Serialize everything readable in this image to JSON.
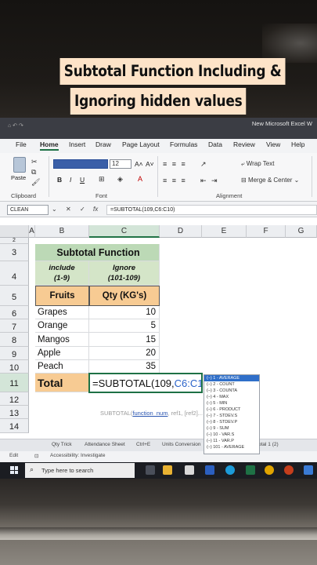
{
  "caption": {
    "line1": "Subtotal Function Including &",
    "line2": "Ignoring hidden values"
  },
  "window": {
    "title": "New Microsoft Excel W"
  },
  "tabs": [
    "File",
    "Home",
    "Insert",
    "Draw",
    "Page Layout",
    "Formulas",
    "Data",
    "Review",
    "View",
    "Help"
  ],
  "ribbon": {
    "paste_label": "Paste",
    "clipboard_label": "Clipboard",
    "font_label": "Font",
    "alignment_label": "Alignment",
    "font_size": "12",
    "bold": "B",
    "italic": "I",
    "underline": "U",
    "wrap_text": "Wrap Text",
    "merge_center": "Merge & Center"
  },
  "formula_bar": {
    "name_box": "CLEAN",
    "fx": "fx",
    "content": "=SUBTOTAL(109,C6:C10)"
  },
  "columns": [
    "A",
    "B",
    "C",
    "D",
    "E",
    "F",
    "G"
  ],
  "rows": [
    "2",
    "3",
    "4",
    "5",
    "6",
    "7",
    "8",
    "9",
    "10",
    "11",
    "12",
    "13",
    "14"
  ],
  "table": {
    "title": "Subtotal Function",
    "include_line1": "include",
    "include_line2": "(1-9)",
    "ignore_line1": "Ignore",
    "ignore_line2": "(101-109)",
    "col_fruits": "Fruits",
    "col_qty": "Qty (KG's)",
    "data": [
      {
        "fruit": "Grapes",
        "qty": "10"
      },
      {
        "fruit": "Orange",
        "qty": "5"
      },
      {
        "fruit": "Mangos",
        "qty": "15"
      },
      {
        "fruit": "Apple",
        "qty": "20"
      },
      {
        "fruit": "Peach",
        "qty": "35"
      }
    ],
    "total_label": "Total",
    "formula_prefix": "=SUBTOTAL(109,",
    "formula_ref": "C6:C10",
    "formula_suffix": ")"
  },
  "tooltip": {
    "prefix": "SUBTOTAL(",
    "fn": "function_num",
    "rest": ", ref1, [ref2]..."
  },
  "autocomplete": [
    "(–) 1 - AVERAGE",
    "(–) 2 - COUNT",
    "(–) 3 - COUNTA",
    "(–) 4 - MAX",
    "(–) 5 - MIN",
    "(–) 6 - PRODUCT",
    "(–) 7 - STDEV.S",
    "(–) 8 - STDEV.P",
    "(–) 9 - SUM",
    "(–) 10 - VAR.S",
    "(–) 11 - VAR.P",
    "(–) 101 - AVERAGE"
  ],
  "sheets": [
    "Qty Trick",
    "Attendance Sheet",
    "Ctrl+E",
    "Units Conversion",
    "otal 1 (2)"
  ],
  "status": {
    "mode": "Edit",
    "accessibility": "Accessibility: Investigate"
  },
  "taskbar": {
    "search_placeholder": "Type here to search"
  }
}
